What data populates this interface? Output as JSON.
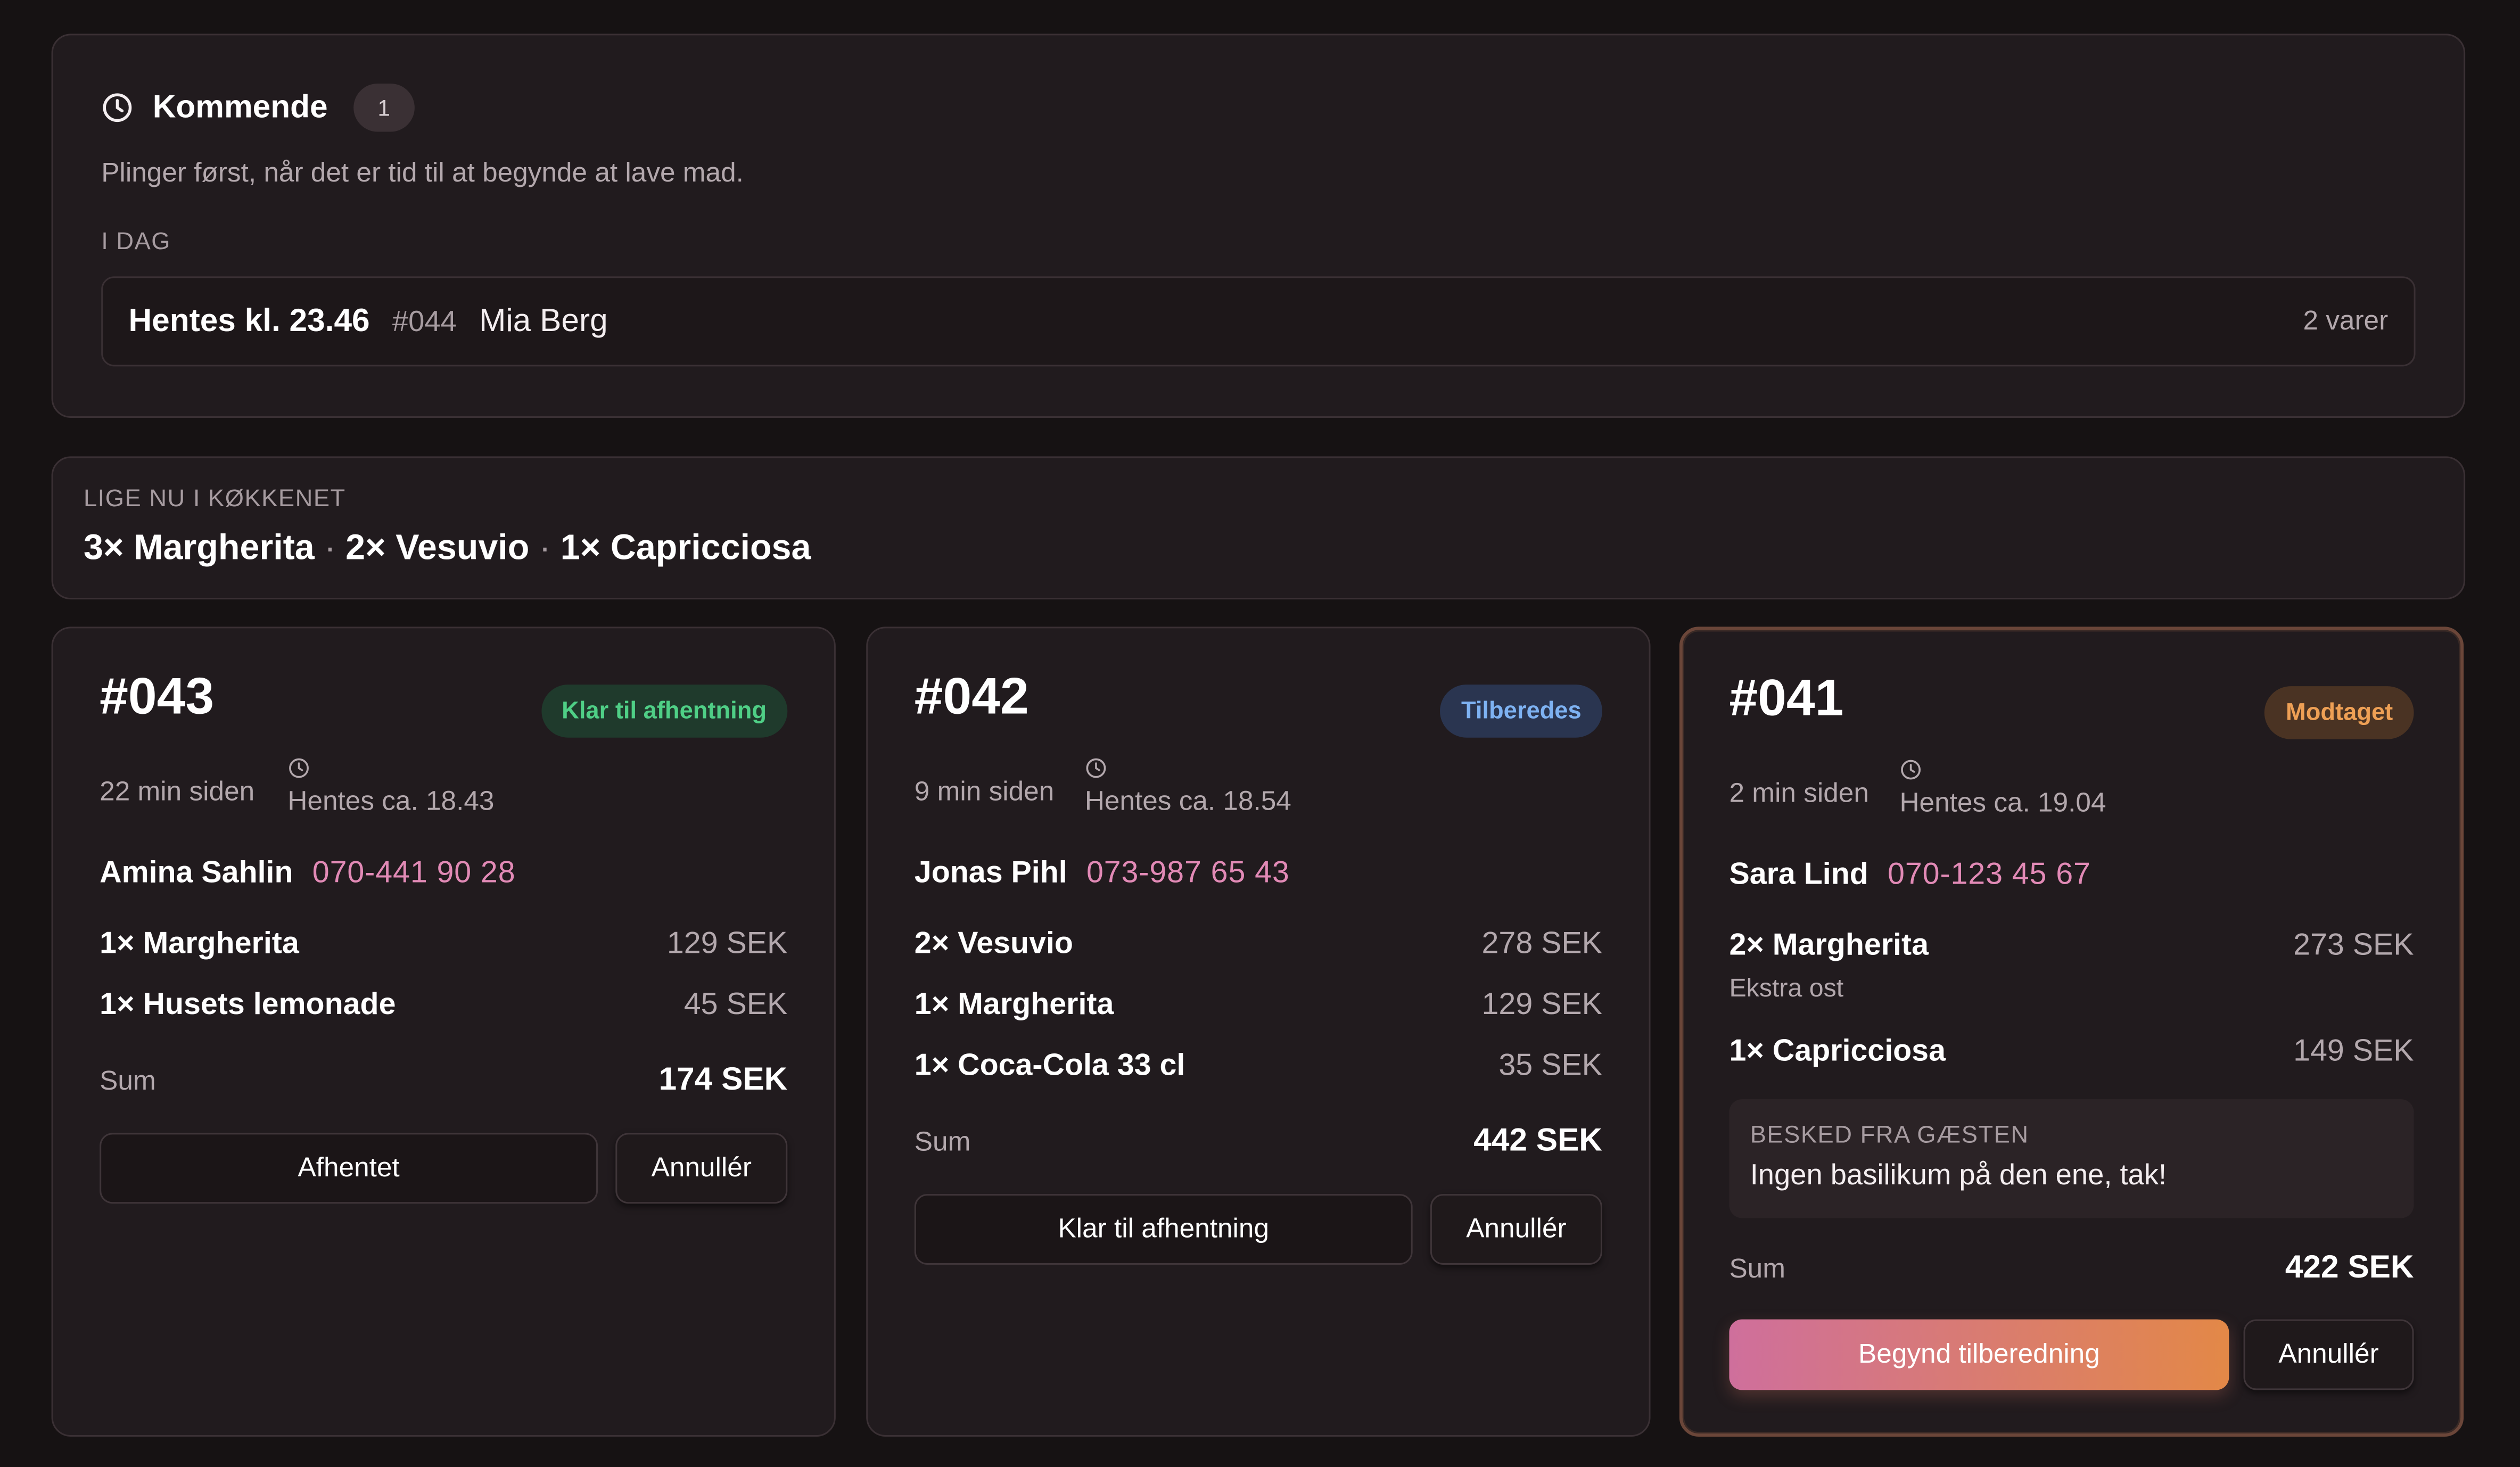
{
  "upcoming": {
    "title": "Kommende",
    "count": "1",
    "subtitle": "Plinger først, når det er tid til at begynde at lave mad.",
    "day_label": "I DAG",
    "orders": [
      {
        "pickup": "Hentes kl. 23.46",
        "number": "#044",
        "name": "Mia Berg",
        "items": "2 varer"
      }
    ]
  },
  "kitchen_now": {
    "label": "LIGE NU I KØKKENET",
    "items": [
      "3× Margherita",
      "2× Vesuvio",
      "1× Capricciosa"
    ],
    "separator": "·"
  },
  "orders": [
    {
      "number": "#043",
      "status": "Klar til afhentning",
      "ago": "22 min siden",
      "pickup": "Hentes ca. 18.43",
      "customer": "Amina Sahlin",
      "phone": "070-441 90 28",
      "items": [
        {
          "name": "1× Margherita",
          "price": "129 SEK"
        },
        {
          "name": "1× Husets lemonade",
          "price": "45 SEK"
        }
      ],
      "sum_label": "Sum",
      "sum": "174 SEK",
      "primary_action": "Afhentet",
      "cancel_action": "Annullér"
    },
    {
      "number": "#042",
      "status": "Tilberedes",
      "ago": "9 min siden",
      "pickup": "Hentes ca. 18.54",
      "customer": "Jonas Pihl",
      "phone": "073-987 65 43",
      "items": [
        {
          "name": "2× Vesuvio",
          "price": "278 SEK"
        },
        {
          "name": "1× Margherita",
          "price": "129 SEK"
        },
        {
          "name": "1× Coca-Cola 33 cl",
          "price": "35 SEK"
        }
      ],
      "sum_label": "Sum",
      "sum": "442 SEK",
      "primary_action": "Klar til afhentning",
      "cancel_action": "Annullér"
    },
    {
      "number": "#041",
      "status": "Modtaget",
      "ago": "2 min siden",
      "pickup": "Hentes ca. 19.04",
      "customer": "Sara Lind",
      "phone": "070-123 45 67",
      "items": [
        {
          "name": "2× Margherita",
          "price": "273 SEK",
          "note": "Ekstra ost"
        },
        {
          "name": "1× Capricciosa",
          "price": "149 SEK"
        }
      ],
      "message_label": "BESKED FRA GÆSTEN",
      "message": "Ingen basilikum på den ene, tak!",
      "sum_label": "Sum",
      "sum": "422 SEK",
      "primary_action": "Begynd tilberedning",
      "cancel_action": "Annullér"
    }
  ],
  "colors": {
    "status_ready": "#4fcf86",
    "status_preparing": "#7eb2f2",
    "status_received": "#eea055",
    "phone": "#e28ab6",
    "primary_gradient_start": "#cf6f9c",
    "primary_gradient_end": "#e38847"
  },
  "icons": {
    "clock": "clock-icon"
  }
}
